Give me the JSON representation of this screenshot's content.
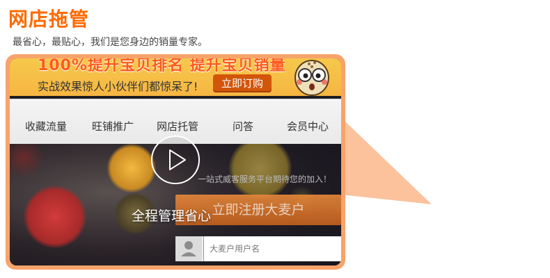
{
  "header": {
    "title": "网店拖管",
    "subtitle": "最省心，最贴心，我们是您身边的销量专家。"
  },
  "banner": {
    "headline": "100%提升宝贝排名  提升宝贝销量",
    "tagline": "实战效果惊人小伙伴们都惊呆了!",
    "cta_label": "立即订购"
  },
  "nav": {
    "items": [
      "收藏流量",
      "旺铺推广",
      "网店托管",
      "问答",
      "会员中心"
    ]
  },
  "hero": {
    "slogan": "一站式威客服务平台期待您的加入！",
    "register_label": "立即注册大麦户",
    "username_placeholder": "大麦户用户名"
  },
  "video": {
    "caption": "全程管理省心"
  },
  "colors": {
    "accent": "#ff6a00",
    "frame": "#f8a36a",
    "callout": "#fbc29c"
  }
}
